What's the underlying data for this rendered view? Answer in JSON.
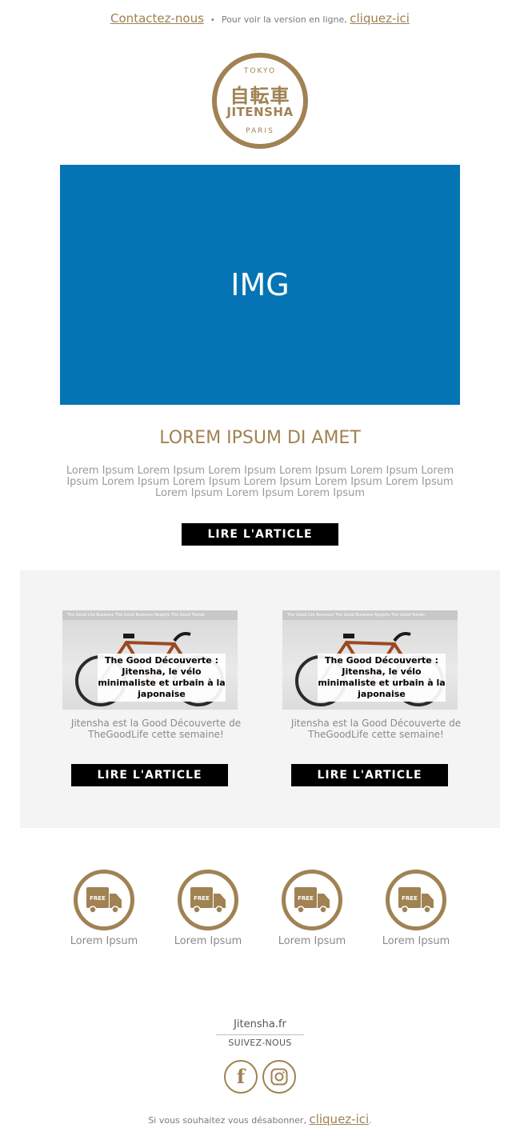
{
  "header": {
    "contact_label": "Contactez-nous",
    "separator": "•",
    "online_text": "Pour voir la version en ligne,",
    "online_link": "cliquez-ici"
  },
  "logo": {
    "top_text": "TOKYO",
    "kanji": "自転車",
    "brand": "JITENSHA",
    "bottom_text": "PARIS"
  },
  "hero": {
    "placeholder": "IMG",
    "background": "#0474b4"
  },
  "article": {
    "title": "LOREM IPSUM DI AMET",
    "body": "Lorem Ipsum Lorem Ipsum Lorem Ipsum Lorem Ipsum Lorem Ipsum Lorem Ipsum Lorem Ipsum Lorem Ipsum Lorem Ipsum Lorem Ipsum Lorem Ipsum Lorem Ipsum Lorem Ipsum Lorem Ipsum",
    "button": "LIRE L'ARTICLE"
  },
  "cards": [
    {
      "thumb_nav": "The Good Life   Business   The Good Business   Reports   The Good Trends",
      "thumb_caption": "The Good Découverte : Jitensha, le vélo minimaliste et urbain à la japonaise",
      "text": "Jitensha est la Good Découverte de TheGoodLife cette semaine!",
      "button": "LIRE L'ARTICLE"
    },
    {
      "thumb_nav": "The Good Life   Business   The Good Business   Reports   The Good Trends",
      "thumb_caption": "The Good Découverte : Jitensha, le vélo minimaliste et urbain à la japonaise",
      "text": "Jitensha est la Good Découverte de TheGoodLife cette semaine!",
      "button": "LIRE L'ARTICLE"
    }
  ],
  "features": [
    {
      "icon": "free-delivery-truck-icon",
      "badge": "FREE",
      "label": "Lorem Ipsum"
    },
    {
      "icon": "free-delivery-truck-icon",
      "badge": "FREE",
      "label": "Lorem Ipsum"
    },
    {
      "icon": "free-delivery-truck-icon",
      "badge": "FREE",
      "label": "Lorem Ipsum"
    },
    {
      "icon": "free-delivery-truck-icon",
      "badge": "FREE",
      "label": "Lorem Ipsum"
    }
  ],
  "footer": {
    "site": "Jitensha.fr",
    "follow": "SUIVEZ-NOUS",
    "facebook_glyph": "f",
    "unsub_text": "Si vous souhaitez vous désabonner,",
    "unsub_link": "cliquez-ici",
    "unsub_end": "."
  },
  "colors": {
    "accent": "#a08253",
    "button": "#000000",
    "panel": "#f4f4f4"
  }
}
